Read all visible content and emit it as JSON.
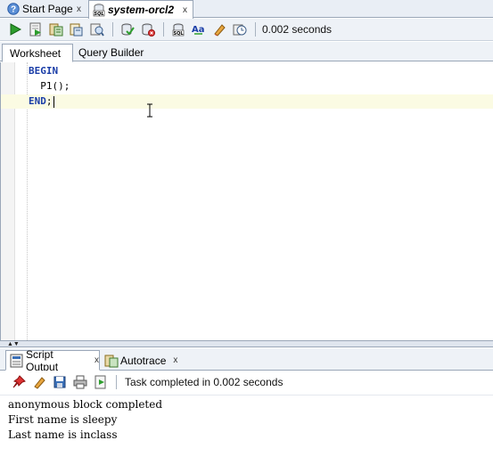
{
  "doc_tabs": [
    {
      "label": "Start Page",
      "icon": "help-circle-icon",
      "closable": true
    },
    {
      "label": "system-orcl2",
      "icon": "sql-worksheet-icon",
      "closable": true,
      "active": true
    }
  ],
  "toolbar": {
    "buttons": [
      "run-statement-icon",
      "run-script-icon",
      "autotrace-icon",
      "explain-plan-icon",
      "sql-tuning-icon",
      "commit-icon",
      "rollback-icon",
      "unshared-sql-icon",
      "to-upper-lower-icon",
      "clear-icon",
      "history-icon"
    ],
    "elapsed": "0.002 seconds"
  },
  "sub_tabs": [
    {
      "label": "Worksheet",
      "active": true
    },
    {
      "label": "Query Builder",
      "active": false
    }
  ],
  "editor": {
    "lines": [
      {
        "keyword": "BEGIN",
        "text": ""
      },
      {
        "keyword": "",
        "text": "  P1();"
      },
      {
        "keyword": "END",
        "text": ";"
      }
    ]
  },
  "output_tabs": [
    {
      "label": "Script Output",
      "icon": "script-output-icon",
      "closable": true,
      "active": true
    },
    {
      "label": "Autotrace",
      "icon": "autotrace-icon",
      "closable": true,
      "active": false
    }
  ],
  "output_toolbar": {
    "buttons": [
      "pin-icon",
      "eraser-icon",
      "save-icon",
      "print-icon",
      "run-icon"
    ],
    "status": "Task completed in 0.002 seconds"
  },
  "output": {
    "lines": [
      "anonymous block completed",
      "First name is sleepy",
      "Last name is inclass"
    ]
  },
  "colors": {
    "keyword": "#1b3ea8",
    "current_line": "#fbfbe3",
    "run_green": "#2e9e2e"
  }
}
